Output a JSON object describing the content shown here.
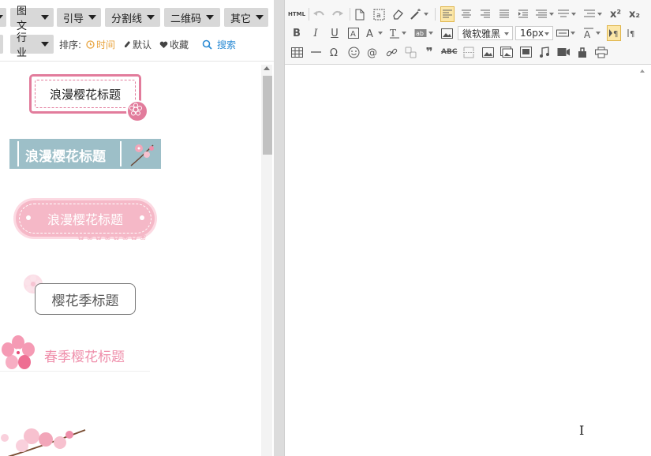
{
  "left_panel": {
    "categories": [
      "图文",
      "引导",
      "分割线",
      "二维码",
      "其它"
    ],
    "industry": "行业",
    "sort_label": "排序:",
    "sort_options": {
      "time": "时间",
      "default": "默认",
      "favorite": "收藏"
    },
    "search_label": "搜索",
    "templates": {
      "t1": "浪漫樱花标题",
      "t2": "浪漫樱花标题",
      "t3": "浪漫樱花标题",
      "t4": "樱花季标题",
      "t5": "春季樱花标题"
    }
  },
  "editor_toolbar": {
    "html_label": "HTML",
    "bold": "B",
    "italic": "I",
    "underline": "U",
    "superscript": "x²",
    "subscript": "x₂",
    "font_family": "微软雅黑",
    "font_size": "16px",
    "quote": "❞",
    "spellcheck": "ABC"
  },
  "colors": {
    "accent": "#e27c9c",
    "pink_light": "#f5b8c7",
    "teal_banner": "#9dbfc8",
    "sort_active": "#e8a33d",
    "search_blue": "#2a8ad4",
    "toolbar_active_bg": "#fce7a8"
  }
}
